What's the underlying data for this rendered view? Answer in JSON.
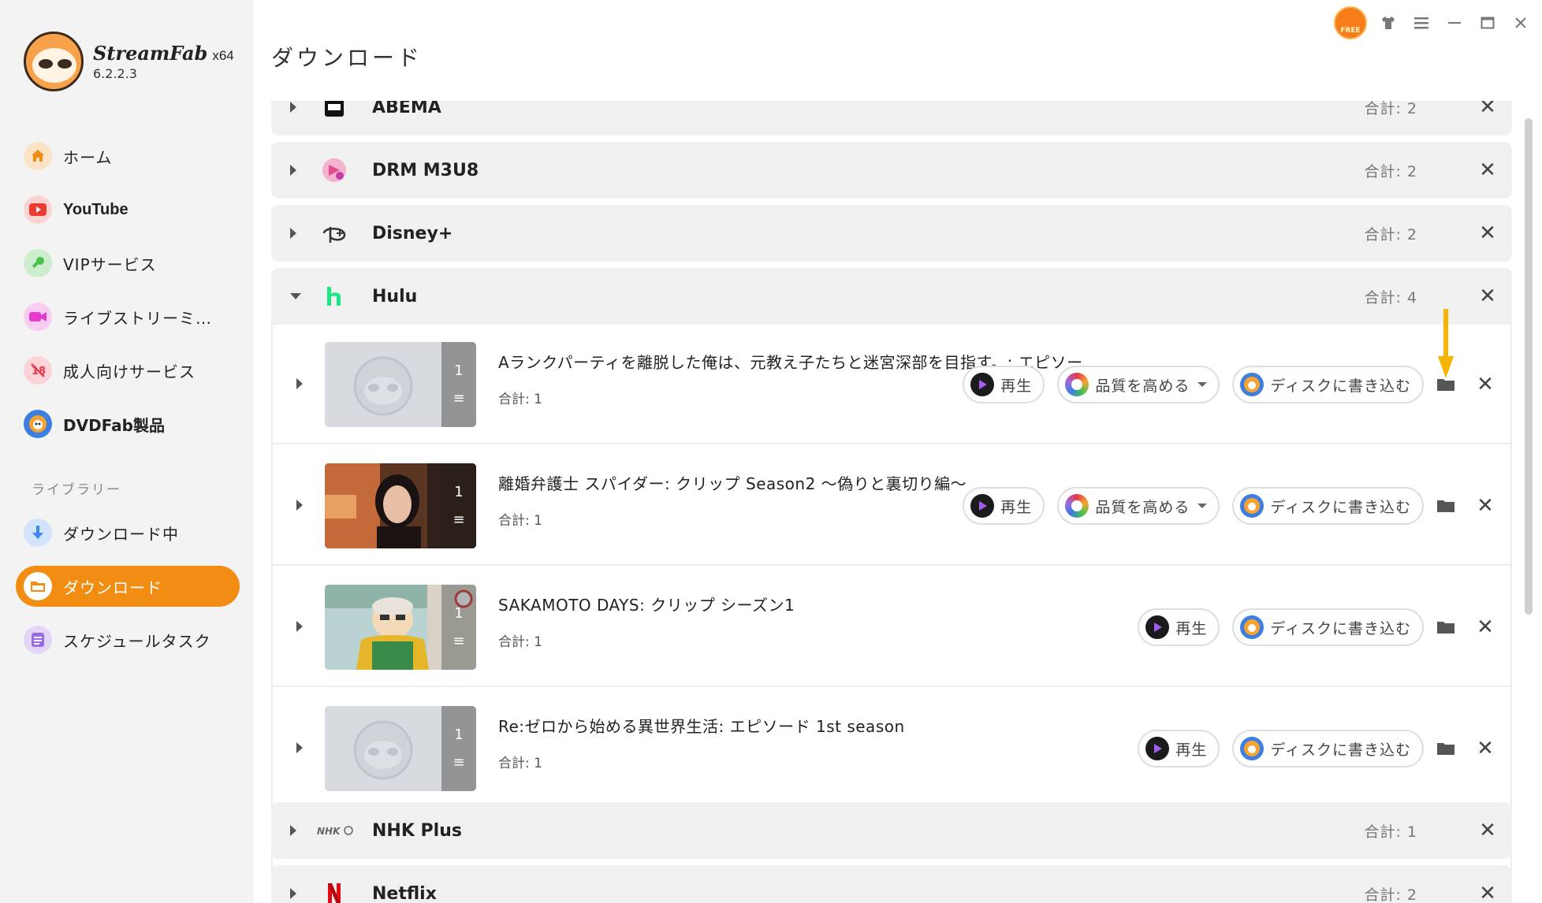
{
  "app": {
    "name": "StreamFab",
    "arch": "x64",
    "version": "6.2.2.3",
    "free_badge": "FREE"
  },
  "page_title": "ダウンロード",
  "sidebar": {
    "items": [
      {
        "label": "ホーム",
        "icon": "home-icon",
        "color": "#f28d13"
      },
      {
        "label": "YouTube",
        "icon": "youtube-icon",
        "color": "#ea3a33"
      },
      {
        "label": "VIPサービス",
        "icon": "key-icon",
        "color": "#49c24a"
      },
      {
        "label": "ライブストリーミ…",
        "icon": "video-camera-icon",
        "color": "#e63ccd"
      },
      {
        "label": "成人向けサービス",
        "icon": "adult-18-icon",
        "color": "#e8384a"
      },
      {
        "label": "DVDFab製品",
        "icon": "dvdfab-icon",
        "color": "#3d7ee0"
      }
    ],
    "library_title": "ライブラリー",
    "library_items": [
      {
        "label": "ダウンロード中",
        "icon": "download-arrow-icon",
        "color": "#3f8ae8"
      },
      {
        "label": "ダウンロード",
        "icon": "folder-icon",
        "color": "#f28d13",
        "active": true
      },
      {
        "label": "スケジュールタスク",
        "icon": "schedule-list-icon",
        "color": "#9b6ae0"
      }
    ]
  },
  "groups": [
    {
      "name": "ABEMA",
      "total": "合計: 2",
      "icon": "abema-logo-icon"
    },
    {
      "name": "DRM M3U8",
      "total": "合計: 2",
      "icon": "drm-m3u8-logo-icon"
    },
    {
      "name": "Disney+",
      "total": "合計: 2",
      "icon": "disney-plus-logo-icon"
    },
    {
      "name": "Hulu",
      "total": "合計: 4",
      "icon": "hulu-logo-icon",
      "expanded": true
    },
    {
      "name": "NHK Plus",
      "total": "合計: 1",
      "icon": "nhk-plus-logo-icon"
    },
    {
      "name": "Netflix",
      "total": "合計: 2",
      "icon": "netflix-logo-icon"
    }
  ],
  "hulu_items": [
    {
      "title": "Aランクパーティを離脱した俺は、元教え子たちと迷宮深部を目指す。: エピソー...",
      "total": "合計: 1",
      "count": "1",
      "thumb": "placeholder-sloth",
      "has_enhance": true
    },
    {
      "title": "離婚弁護士 スパイダー: クリップ Season2 〜偽りと裏切り編〜",
      "total": "合計: 1",
      "count": "1",
      "thumb": "woman-portrait",
      "has_enhance": true
    },
    {
      "title": "SAKAMOTO DAYS: クリップ シーズン1",
      "total": "合計: 1",
      "count": "1",
      "thumb": "anime-shopkeeper",
      "has_enhance": false
    },
    {
      "title": "Re:ゼロから始める異世界生活: エピソード 1st season",
      "total": "合計: 1",
      "count": "1",
      "thumb": "placeholder-sloth",
      "has_enhance": false
    }
  ],
  "actions": {
    "play": "再生",
    "enhance": "品質を高める",
    "burn": "ディスクに書き込む"
  },
  "colors": {
    "accent": "#f28d13",
    "group_bg": "#f0f0f0",
    "hint_arrow": "#f6b400"
  }
}
